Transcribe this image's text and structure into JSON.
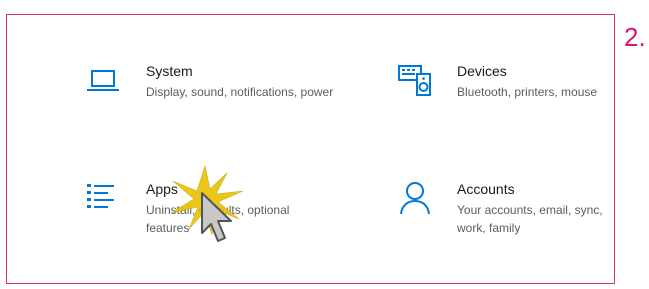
{
  "step_label": "2.",
  "tiles": [
    {
      "title": "System",
      "description": "Display, sound, notifications, power",
      "icon": "laptop-icon"
    },
    {
      "title": "Devices",
      "description": "Bluetooth, printers, mouse",
      "icon": "keyboard-speaker-icon"
    },
    {
      "title": "Apps",
      "description": "Uninstall, defaults, optional features",
      "icon": "apps-list-icon"
    },
    {
      "title": "Accounts",
      "description": "Your accounts, email, sync, work, family",
      "icon": "person-icon"
    }
  ],
  "colors": {
    "accent": "#0078d7",
    "frame_border": "#d63a5a",
    "step_number": "#e0116f",
    "title_text": "#1a1a1a",
    "desc_text": "#5d5d5d",
    "burst": "#e8c200"
  },
  "overlay": {
    "cursor_icon": "pointer-cursor-icon",
    "click_effect_icon": "click-burst-icon"
  }
}
